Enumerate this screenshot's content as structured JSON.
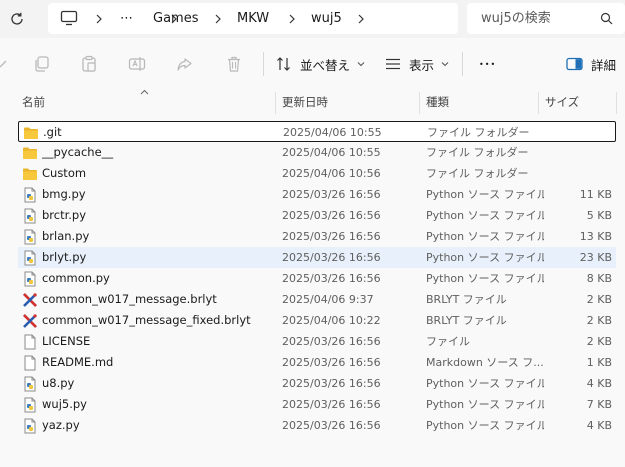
{
  "address_bar": {
    "breadcrumbs": [
      "Games",
      "MKW",
      "wuj5"
    ],
    "more_label": "⋯",
    "search_placeholder": "wuj5の検索"
  },
  "toolbar": {
    "sort_label": "並べ替え",
    "view_label": "表示",
    "more_label": "•••",
    "details_label": "詳細"
  },
  "columns": {
    "name": "名前",
    "date": "更新日時",
    "type": "種類",
    "size": "サイズ"
  },
  "files": [
    {
      "name": ".git",
      "date": "2025/04/06 10:55",
      "type": "ファイル フォルダー",
      "size": "",
      "icon": "folder-icon"
    },
    {
      "name": "__pycache__",
      "date": "2025/04/06 10:55",
      "type": "ファイル フォルダー",
      "size": "",
      "icon": "folder-icon"
    },
    {
      "name": "Custom",
      "date": "2025/04/06 10:56",
      "type": "ファイル フォルダー",
      "size": "",
      "icon": "folder-icon"
    },
    {
      "name": "bmg.py",
      "date": "2025/03/26 16:56",
      "type": "Python ソース ファイル",
      "size": "11 KB",
      "icon": "python-file-icon"
    },
    {
      "name": "brctr.py",
      "date": "2025/03/26 16:56",
      "type": "Python ソース ファイル",
      "size": "5 KB",
      "icon": "python-file-icon"
    },
    {
      "name": "brlan.py",
      "date": "2025/03/26 16:56",
      "type": "Python ソース ファイル",
      "size": "13 KB",
      "icon": "python-file-icon"
    },
    {
      "name": "brlyt.py",
      "date": "2025/03/26 16:56",
      "type": "Python ソース ファイル",
      "size": "23 KB",
      "icon": "python-file-icon"
    },
    {
      "name": "common.py",
      "date": "2025/03/26 16:56",
      "type": "Python ソース ファイル",
      "size": "8 KB",
      "icon": "python-file-icon"
    },
    {
      "name": "common_w017_message.brlyt",
      "date": "2025/04/06 9:37",
      "type": "BRLYT ファイル",
      "size": "2 KB",
      "icon": "brlyt-file-icon"
    },
    {
      "name": "common_w017_message_fixed.brlyt",
      "date": "2025/04/06 10:22",
      "type": "BRLYT ファイル",
      "size": "2 KB",
      "icon": "brlyt-file-icon"
    },
    {
      "name": "LICENSE",
      "date": "2025/03/26 16:56",
      "type": "ファイル",
      "size": "2 KB",
      "icon": "blank-file-icon"
    },
    {
      "name": "README.md",
      "date": "2025/03/26 16:56",
      "type": "Markdown ソース フ...",
      "size": "1 KB",
      "icon": "blank-file-icon"
    },
    {
      "name": "u8.py",
      "date": "2025/03/26 16:56",
      "type": "Python ソース ファイル",
      "size": "4 KB",
      "icon": "python-file-icon"
    },
    {
      "name": "wuj5.py",
      "date": "2025/03/26 16:56",
      "type": "Python ソース ファイル",
      "size": "7 KB",
      "icon": "python-file-icon"
    },
    {
      "name": "yaz.py",
      "date": "2025/03/26 16:56",
      "type": "Python ソース ファイル",
      "size": "4 KB",
      "icon": "python-file-icon"
    }
  ],
  "state": {
    "focused_item": ".git",
    "hovered_item": "brlyt.py"
  },
  "colors": {
    "folder": "#f8c83c",
    "python_accent": "#3d7fc1",
    "hover_bg": "#e8f1fb",
    "accent_blue": "#1f6fb8"
  }
}
